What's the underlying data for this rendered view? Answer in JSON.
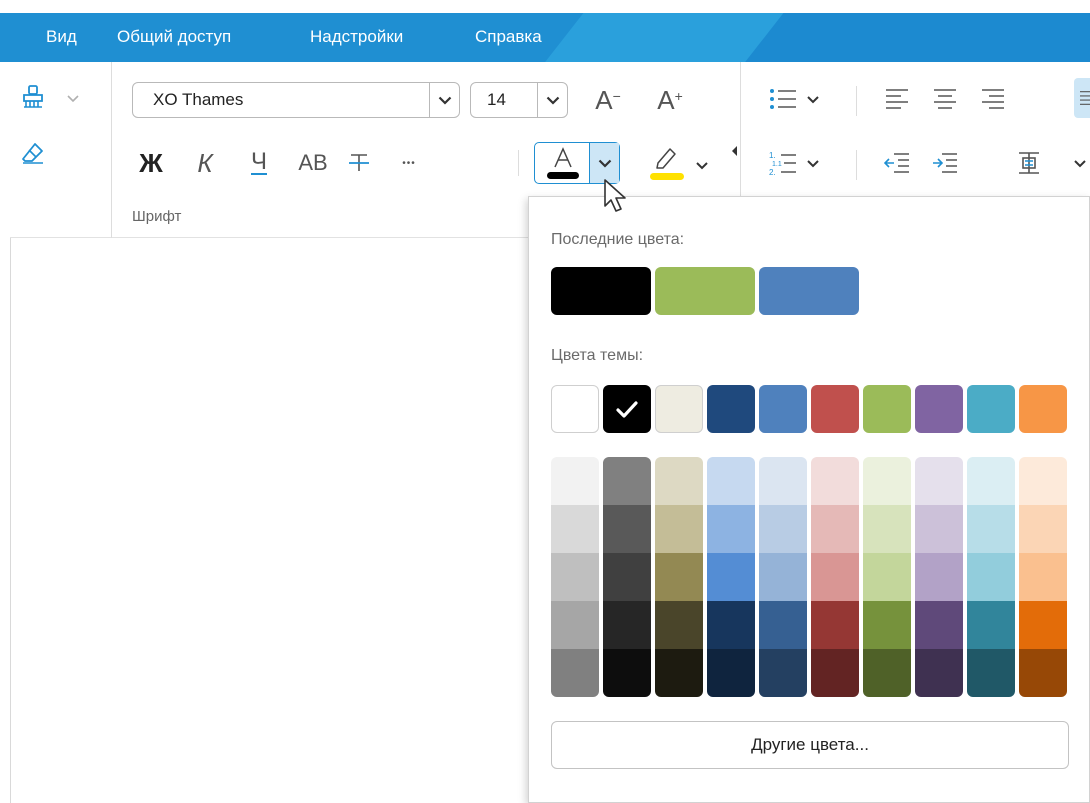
{
  "menu": {
    "items": [
      "Вид",
      "Общий доступ",
      "Надстройки",
      "Справка"
    ],
    "bg_color": "#1f8fd2"
  },
  "ribbon": {
    "font_name": "XO Thames",
    "font_size": "14",
    "font_group_label": "Шрифт",
    "bold_label": "Ж",
    "italic_label": "К",
    "underline_label": "Ч",
    "caps_label": "АВ",
    "more_label": "•••",
    "grow_font_label": "A",
    "shrink_font_label": "A",
    "grow_sup": "+",
    "shrink_sup": "−",
    "font_color_bar": "#000000",
    "highlight_color_bar": "#ffe100",
    "icons": [
      "format-painter-icon",
      "clear-format-icon",
      "bullet-list-icon",
      "numbered-list-icon",
      "align-left-icon",
      "align-center-icon",
      "align-right-icon",
      "justify-icon",
      "decrease-indent-icon",
      "increase-indent-icon",
      "paragraph-spacing-icon"
    ]
  },
  "color_picker": {
    "recent_label": "Последние цвета:",
    "theme_label": "Цвета темы:",
    "more_colors_label": "Другие цвета...",
    "recent_colors": [
      "#000000",
      "#9bbb59",
      "#4f81bd"
    ],
    "theme_colors": [
      "#ffffff",
      "#000000",
      "#eeece1",
      "#1f497d",
      "#4f81bd",
      "#c0504d",
      "#9bbb59",
      "#8064a2",
      "#4bacc6",
      "#f79646"
    ],
    "selected_theme_index": 1,
    "shades": [
      [
        "#f2f2f2",
        "#d9d9d9",
        "#bfbfbf",
        "#a6a6a6",
        "#808080"
      ],
      [
        "#808080",
        "#595959",
        "#404040",
        "#262626",
        "#0d0d0d"
      ],
      [
        "#ddd9c3",
        "#c4bd97",
        "#938953",
        "#4a452a",
        "#1d1b10"
      ],
      [
        "#c6d9f0",
        "#8db3e2",
        "#548dd4",
        "#17365d",
        "#0f243e"
      ],
      [
        "#dbe5f1",
        "#b8cce4",
        "#95b3d7",
        "#366092",
        "#244061"
      ],
      [
        "#f2dcdb",
        "#e5b9b7",
        "#d99694",
        "#953734",
        "#632423"
      ],
      [
        "#ebf1dd",
        "#d7e3bc",
        "#c3d69b",
        "#76923c",
        "#4f6128"
      ],
      [
        "#e5e0ec",
        "#ccc1d9",
        "#b2a2c7",
        "#5f497a",
        "#3f3151"
      ],
      [
        "#dbeef3",
        "#b7dde8",
        "#92cddc",
        "#31859b",
        "#205867"
      ],
      [
        "#fdeada",
        "#fbd5b5",
        "#fac08f",
        "#e36c09",
        "#974806"
      ]
    ]
  }
}
